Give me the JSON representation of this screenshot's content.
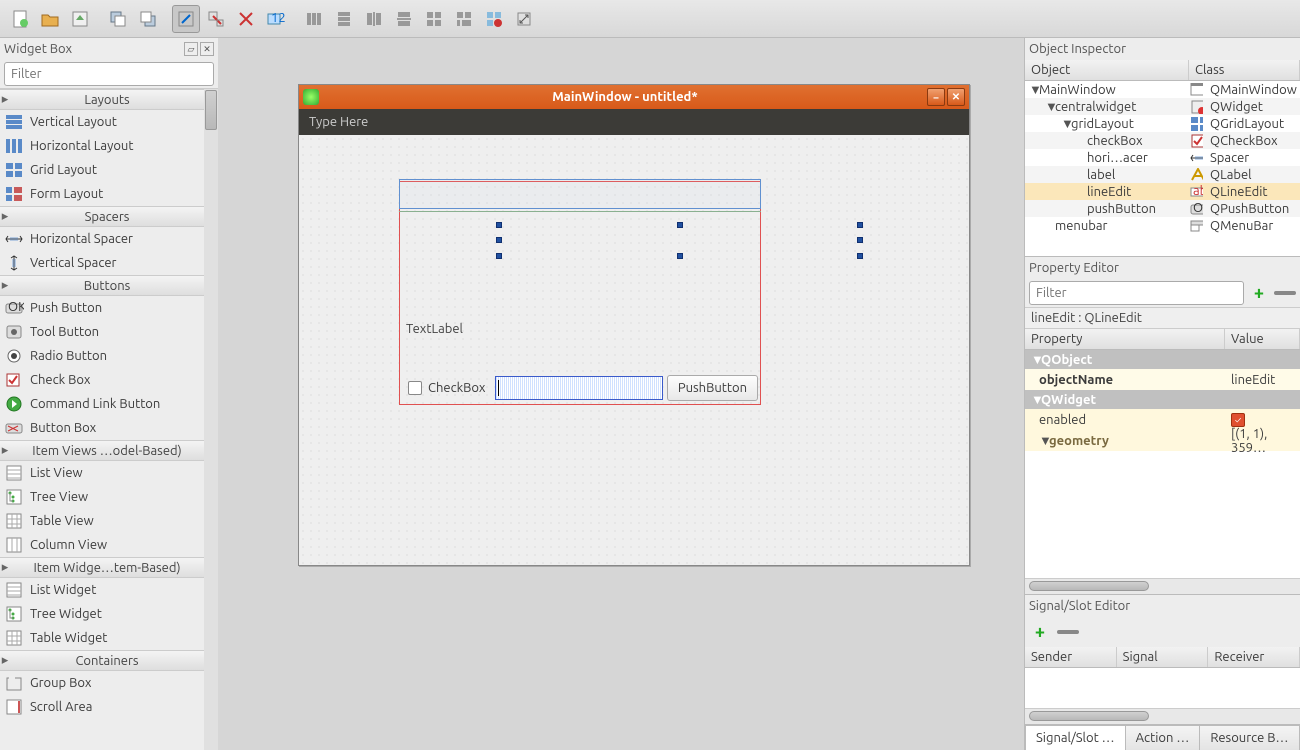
{
  "toolbar_icons": [
    "new",
    "open",
    "save",
    "sep",
    "copy",
    "paste",
    "sep",
    "widget-edit",
    "signal-edit",
    "buddy-edit",
    "tab-edit",
    "sep",
    "hlayout",
    "vlayout",
    "hsplit",
    "vsplit",
    "grid",
    "form-grid",
    "break-layout",
    "adjust-size"
  ],
  "widget_box": {
    "title": "Widget Box",
    "filter_placeholder": "Filter",
    "groups": [
      {
        "name": "Layouts",
        "items": [
          {
            "label": "Vertical Layout",
            "icon": "vlayout"
          },
          {
            "label": "Horizontal Layout",
            "icon": "hlayout"
          },
          {
            "label": "Grid Layout",
            "icon": "grid"
          },
          {
            "label": "Form Layout",
            "icon": "form"
          }
        ]
      },
      {
        "name": "Spacers",
        "items": [
          {
            "label": "Horizontal Spacer",
            "icon": "hspacer"
          },
          {
            "label": "Vertical Spacer",
            "icon": "vspacer"
          }
        ]
      },
      {
        "name": "Buttons",
        "items": [
          {
            "label": "Push Button",
            "icon": "pushbtn"
          },
          {
            "label": "Tool Button",
            "icon": "toolbtn"
          },
          {
            "label": "Radio Button",
            "icon": "radio"
          },
          {
            "label": "Check Box",
            "icon": "check"
          },
          {
            "label": "Command Link Button",
            "icon": "cmdlink"
          },
          {
            "label": "Button Box",
            "icon": "btnbox"
          }
        ]
      },
      {
        "name": "Item Views …odel-Based)",
        "items": [
          {
            "label": "List View",
            "icon": "listview"
          },
          {
            "label": "Tree View",
            "icon": "treeview"
          },
          {
            "label": "Table View",
            "icon": "tableview"
          },
          {
            "label": "Column View",
            "icon": "colview"
          }
        ]
      },
      {
        "name": "Item Widge…tem-Based)",
        "items": [
          {
            "label": "List Widget",
            "icon": "listview"
          },
          {
            "label": "Tree Widget",
            "icon": "treeview"
          },
          {
            "label": "Table Widget",
            "icon": "tableview"
          }
        ]
      },
      {
        "name": "Containers",
        "items": [
          {
            "label": "Group Box",
            "icon": "groupbox"
          },
          {
            "label": "Scroll Area",
            "icon": "scrollarea"
          }
        ]
      }
    ]
  },
  "form": {
    "title": "MainWindow - untitled*",
    "menu_placeholder": "Type Here",
    "label_text": "TextLabel",
    "checkbox_text": "CheckBox",
    "pushbutton_text": "PushButton"
  },
  "inspector": {
    "title": "Object Inspector",
    "cols": {
      "object": "Object",
      "class": "Class"
    },
    "rows": [
      {
        "depth": 0,
        "expand": "▼",
        "obj": "MainWindow",
        "cls": "QMainWindow",
        "icon": "window"
      },
      {
        "depth": 1,
        "expand": "▼",
        "obj": "centralwidget",
        "cls": "QWidget",
        "icon": "widget-red"
      },
      {
        "depth": 2,
        "expand": "▼",
        "obj": "gridLayout",
        "cls": "QGridLayout",
        "icon": "grid"
      },
      {
        "depth": 3,
        "expand": "",
        "obj": "checkBox",
        "cls": "QCheckBox",
        "icon": "check"
      },
      {
        "depth": 3,
        "expand": "",
        "obj": "hori…acer",
        "cls": "Spacer",
        "icon": "hspacer"
      },
      {
        "depth": 3,
        "expand": "",
        "obj": "label",
        "cls": "QLabel",
        "icon": "label"
      },
      {
        "depth": 3,
        "expand": "",
        "obj": "lineEdit",
        "cls": "QLineEdit",
        "icon": "lineedit",
        "selected": true
      },
      {
        "depth": 3,
        "expand": "",
        "obj": "pushButton",
        "cls": "QPushButton",
        "icon": "pushbtn"
      },
      {
        "depth": 1,
        "expand": "",
        "obj": "menubar",
        "cls": "QMenuBar",
        "icon": "menubar"
      }
    ]
  },
  "properties": {
    "title": "Property Editor",
    "filter_placeholder": "Filter",
    "selected": "lineEdit : QLineEdit",
    "cols": {
      "property": "Property",
      "value": "Value"
    },
    "groups": [
      {
        "name": "QObject",
        "rows": [
          {
            "prop": "objectName",
            "val": "lineEdit",
            "changed": true
          }
        ]
      },
      {
        "name": "QWidget",
        "rows": [
          {
            "prop": "enabled",
            "val_check": true
          },
          {
            "prop": "geometry",
            "val": "[(1, 1), 359…",
            "expandable": true,
            "geom": true
          }
        ]
      }
    ]
  },
  "signal": {
    "title": "Signal/Slot Editor",
    "cols": {
      "sender": "Sender",
      "signal": "Signal",
      "receiver": "Receiver"
    }
  },
  "tabs": [
    "Signal/Slot …",
    "Action …",
    "Resource B…"
  ]
}
